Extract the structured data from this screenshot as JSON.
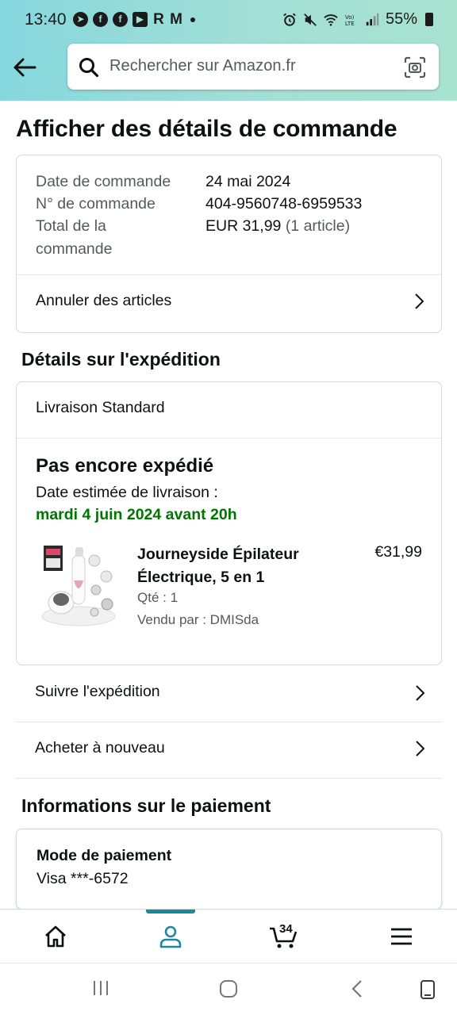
{
  "status_bar": {
    "time": "13:40",
    "notif_r": "R",
    "battery": "55%"
  },
  "search": {
    "placeholder": "Rechercher sur Amazon.fr"
  },
  "page_title": "Afficher des détails de commande",
  "order": {
    "date_label": "Date de commande",
    "date_value": "24 mai 2024",
    "number_label": "N° de commande",
    "number_value": "404-9560748-6959533",
    "total_label_line1": "Total de la",
    "total_label_line2": "commande",
    "total_value": "EUR 31,99",
    "total_items": "(1 article)",
    "cancel_label": "Annuler des articles"
  },
  "shipping": {
    "section_title": "Détails sur l'expédition",
    "method": "Livraison Standard",
    "status": "Pas encore expédié",
    "estimate_label": "Date estimée de livraison :",
    "estimate_date": "mardi 4 juin 2024 avant 20h",
    "product": {
      "name": "Journeyside Épilateur Électrique, 5 en 1",
      "price": "€31,99",
      "qty": "Qté : 1",
      "seller": "Vendu par : DMISda"
    },
    "track_label": "Suivre l'expédition",
    "buy_again_label": "Acheter à nouveau"
  },
  "payment": {
    "section_title": "Informations sur le paiement",
    "method_title": "Mode de paiement",
    "method_value": "Visa ***-6572"
  },
  "bottom_nav": {
    "cart_count": "34",
    "active": "account"
  },
  "colors": {
    "header_gradient_start": "#85d7de",
    "header_gradient_end": "#a8e3cf",
    "delivery_green": "#007600",
    "active_tab": "#1a8a9a"
  }
}
